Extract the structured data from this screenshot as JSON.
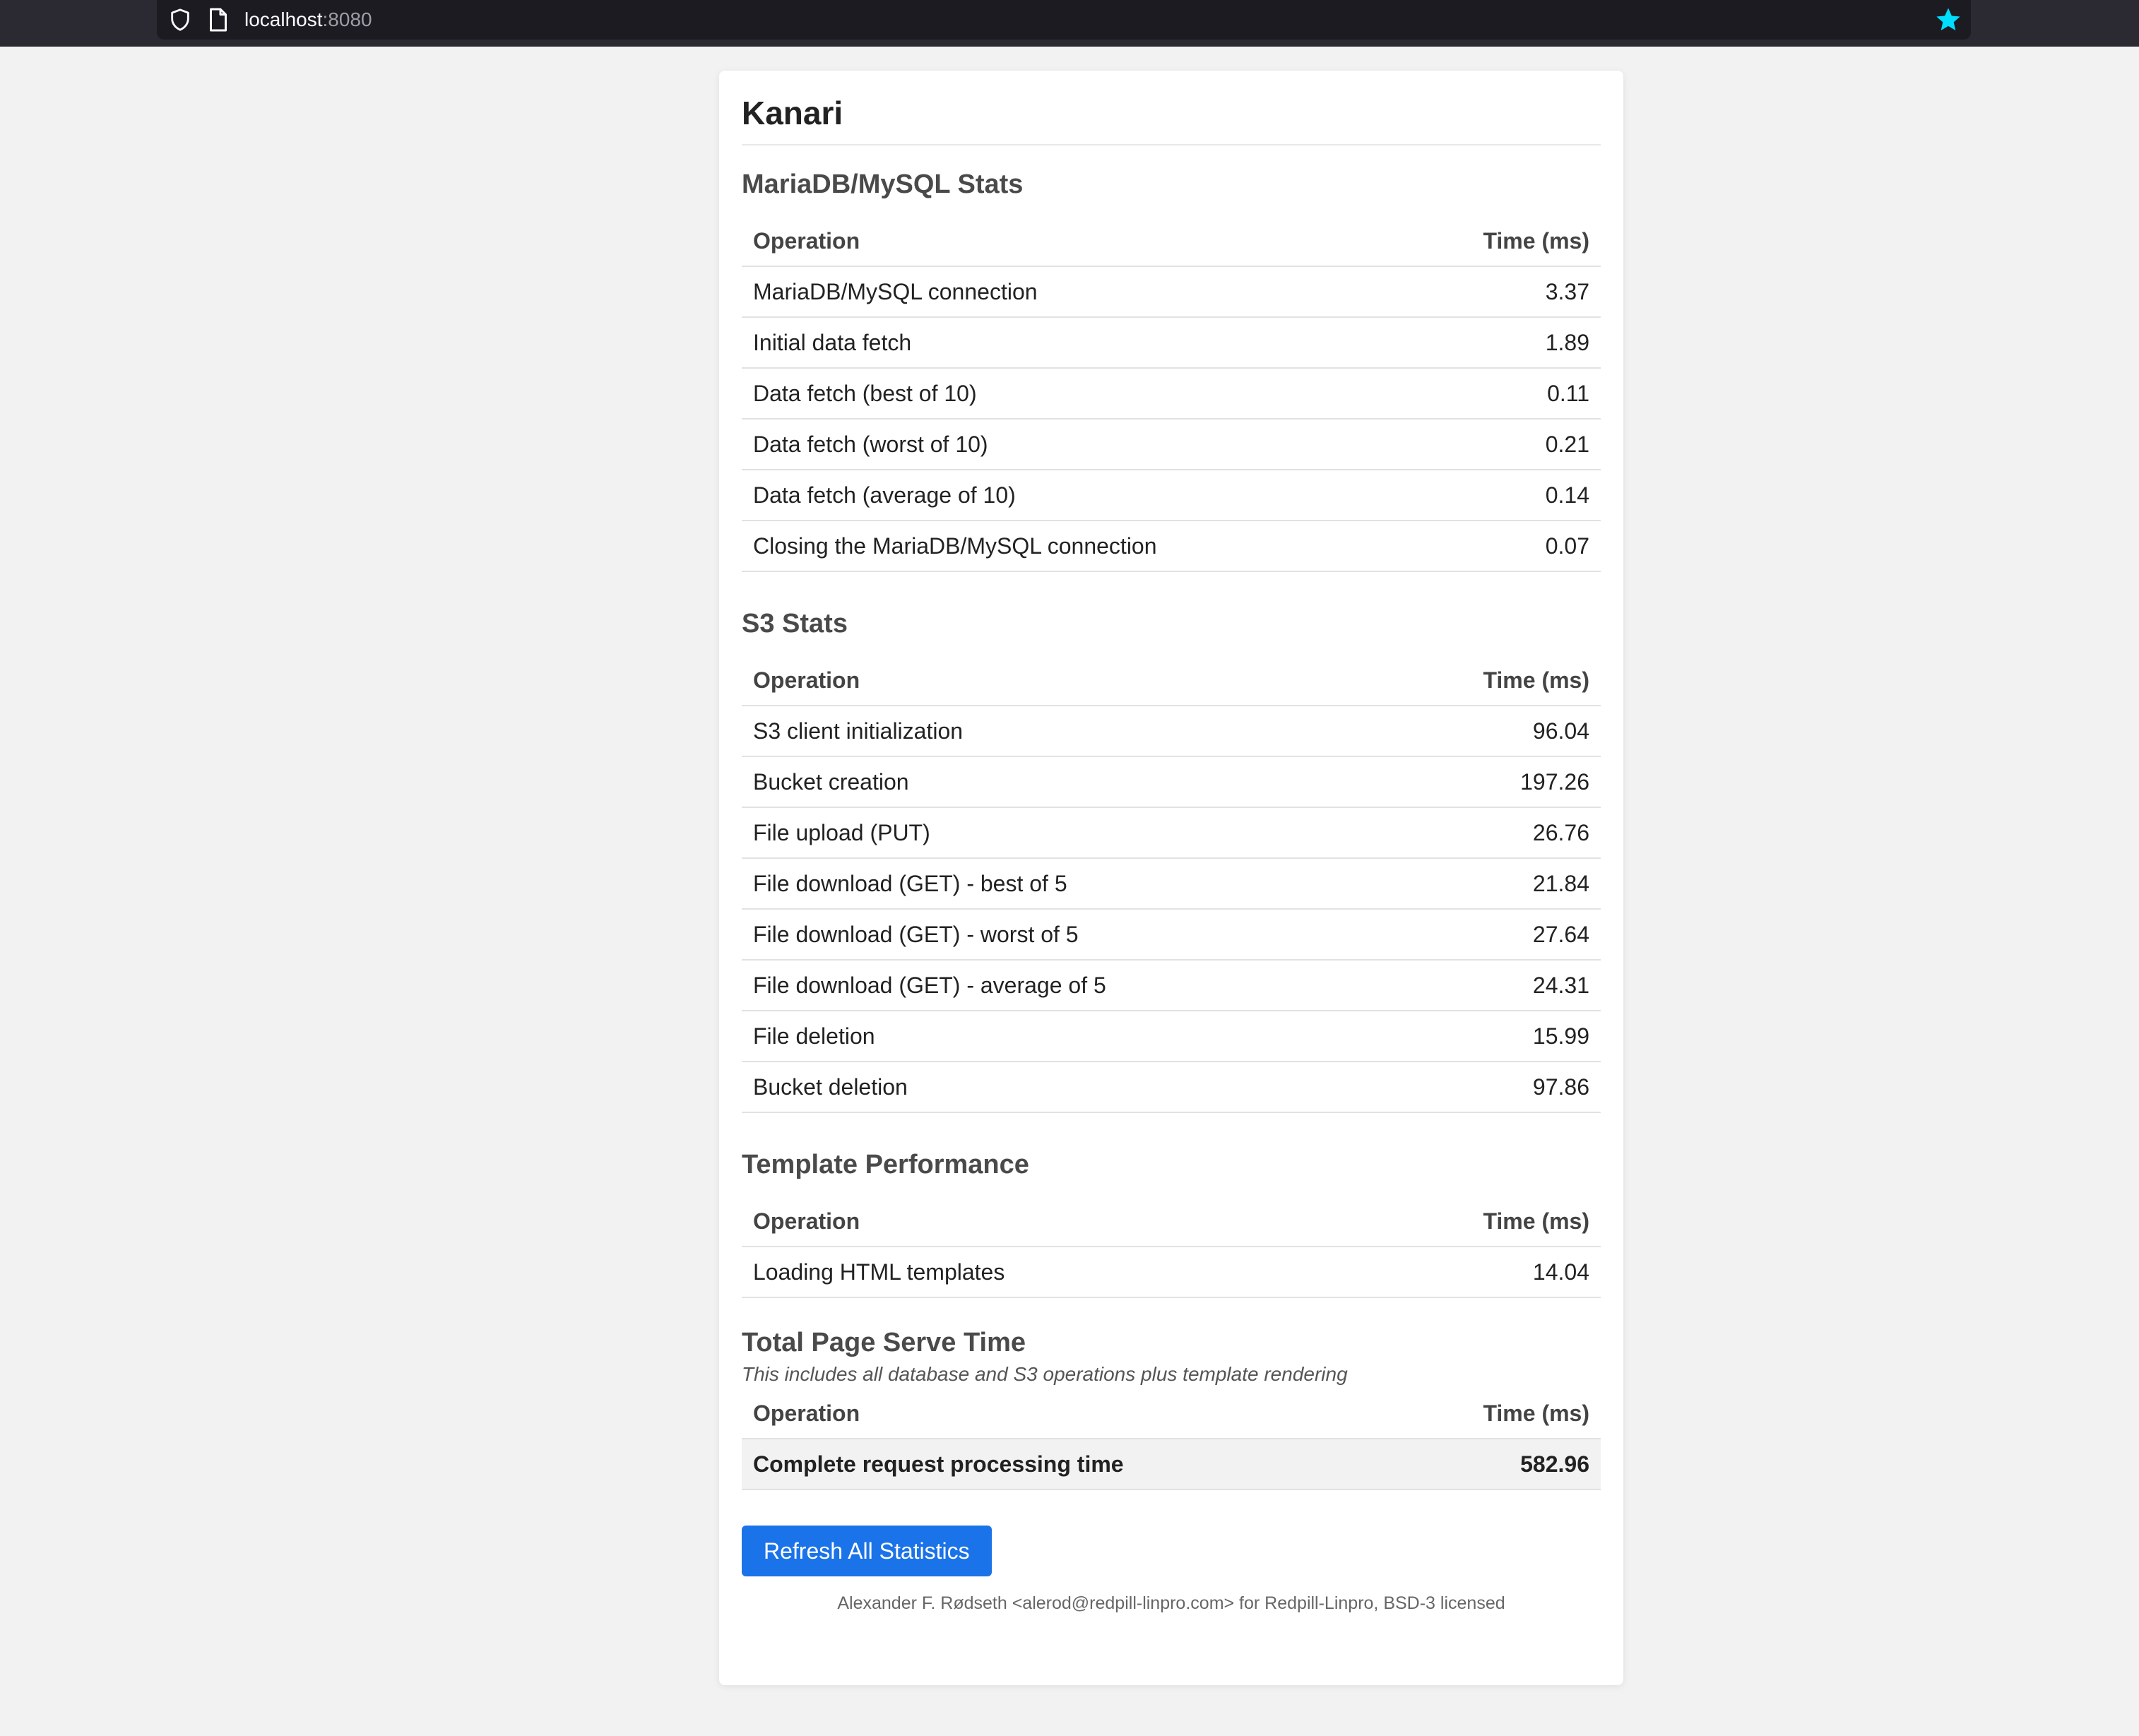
{
  "browser": {
    "url_host": "localhost",
    "url_port": ":8080"
  },
  "page": {
    "title": "Kanari"
  },
  "sections": [
    {
      "title": "MariaDB/MySQL Stats",
      "col_operation": "Operation",
      "col_time": "Time (ms)",
      "rows": [
        {
          "op": "MariaDB/MySQL connection",
          "time": "3.37"
        },
        {
          "op": "Initial data fetch",
          "time": "1.89"
        },
        {
          "op": "Data fetch (best of 10)",
          "time": "0.11"
        },
        {
          "op": "Data fetch (worst of 10)",
          "time": "0.21"
        },
        {
          "op": "Data fetch (average of 10)",
          "time": "0.14"
        },
        {
          "op": "Closing the MariaDB/MySQL connection",
          "time": "0.07"
        }
      ]
    },
    {
      "title": "S3 Stats",
      "col_operation": "Operation",
      "col_time": "Time (ms)",
      "rows": [
        {
          "op": "S3 client initialization",
          "time": "96.04"
        },
        {
          "op": "Bucket creation",
          "time": "197.26"
        },
        {
          "op": "File upload (PUT)",
          "time": "26.76"
        },
        {
          "op": "File download (GET) - best of 5",
          "time": "21.84"
        },
        {
          "op": "File download (GET) - worst of 5",
          "time": "27.64"
        },
        {
          "op": "File download (GET) - average of 5",
          "time": "24.31"
        },
        {
          "op": "File deletion",
          "time": "15.99"
        },
        {
          "op": "Bucket deletion",
          "time": "97.86"
        }
      ]
    },
    {
      "title": "Template Performance",
      "col_operation": "Operation",
      "col_time": "Time (ms)",
      "rows": [
        {
          "op": "Loading HTML templates",
          "time": "14.04"
        }
      ]
    },
    {
      "title": "Total Page Serve Time",
      "note": "This includes all database and S3 operations plus template rendering",
      "col_operation": "Operation",
      "col_time": "Time (ms)",
      "rows": [
        {
          "op": "Complete request processing time",
          "time": "582.96"
        }
      ]
    }
  ],
  "refresh_button": "Refresh All Statistics",
  "footer": "Alexander F. Rødseth <alerod@redpill-linpro.com> for Redpill-Linpro, BSD-3 licensed",
  "colors": {
    "accent": "#1a73e8",
    "bookmark_star": "#00ddff"
  }
}
